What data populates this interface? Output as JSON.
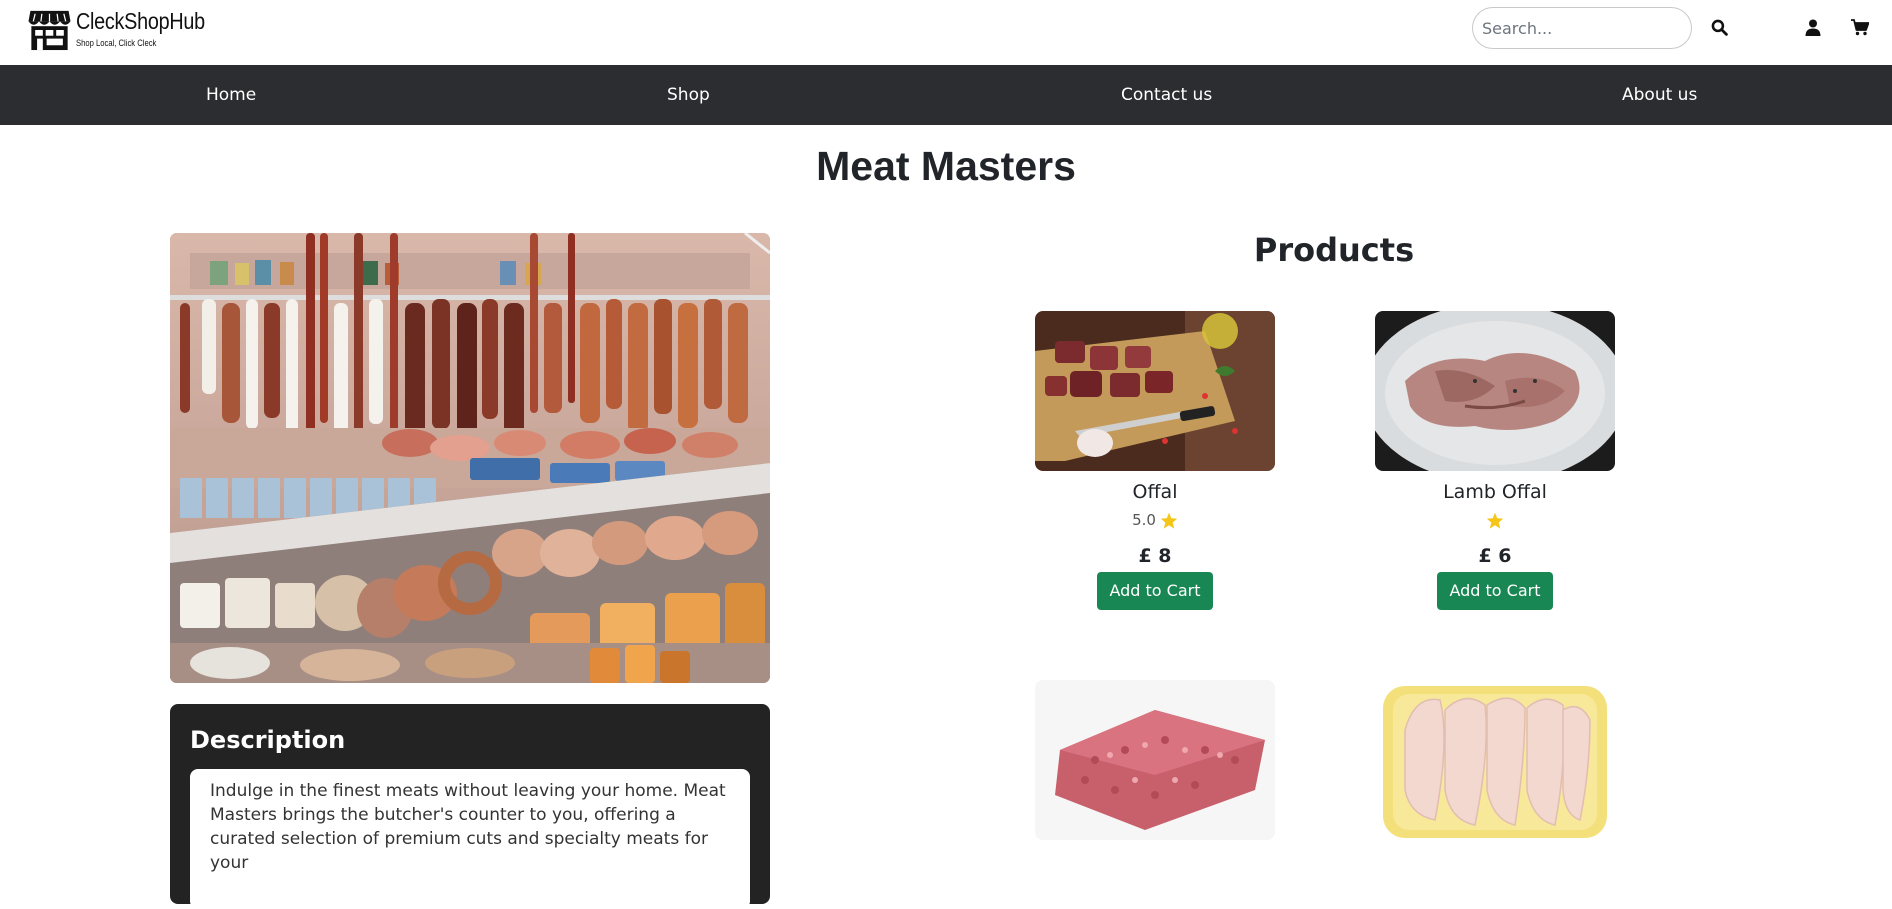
{
  "brand": {
    "name": "CleckShopHub",
    "tagline": "Shop Local, Click Cleck"
  },
  "header": {
    "search_placeholder": "Search..."
  },
  "nav": {
    "items": [
      {
        "label": "Home"
      },
      {
        "label": "Shop"
      },
      {
        "label": "Contact us"
      },
      {
        "label": "About us"
      }
    ]
  },
  "shop": {
    "title": "Meat Masters",
    "description_heading": "Description",
    "description_text": "Indulge in the finest meats without leaving your home. Meat Masters brings the butcher's counter to you, offering a curated selection of premium cuts and specialty meats for your"
  },
  "products": {
    "heading": "Products",
    "items": [
      {
        "name": "Offal",
        "rating": "5.0",
        "price": "£ 8",
        "button": "Add to Cart"
      },
      {
        "name": "Lamb Offal",
        "rating": "",
        "price": "£ 6",
        "button": "Add to Cart"
      },
      {
        "name": "",
        "rating": "",
        "price": "",
        "button": ""
      },
      {
        "name": "",
        "rating": "",
        "price": "",
        "button": ""
      }
    ]
  },
  "colors": {
    "nav_bg": "#2b2d31",
    "accent_green": "#198754",
    "star": "#f5c518",
    "desc_card_bg": "#232323"
  },
  "icons": [
    "storefront-icon",
    "search-icon",
    "user-icon",
    "cart-icon",
    "star-icon"
  ]
}
